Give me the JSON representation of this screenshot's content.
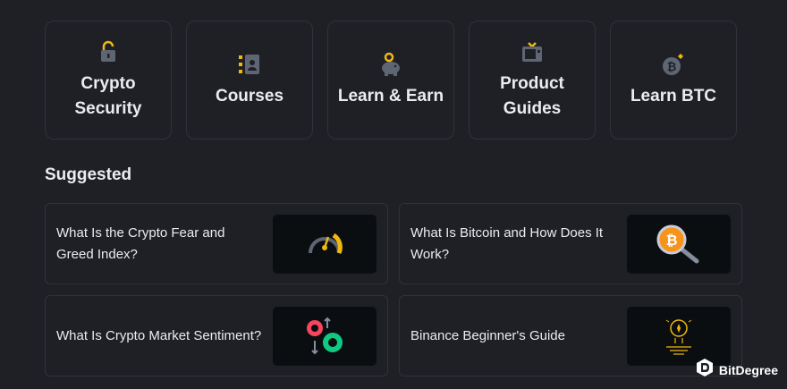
{
  "categories": [
    {
      "label": "Crypto Security",
      "icon": "padlock-icon"
    },
    {
      "label": "Courses",
      "icon": "course-book-icon"
    },
    {
      "label": "Learn & Earn",
      "icon": "piggy-bank-icon"
    },
    {
      "label": "Product Guides",
      "icon": "tv-screen-icon"
    },
    {
      "label": "Learn BTC",
      "icon": "bitcoin-bomb-icon"
    }
  ],
  "suggested": {
    "title": "Suggested",
    "items": [
      {
        "title": "What Is the Crypto Fear and Greed Index?",
        "thumb": "gauge-icon"
      },
      {
        "title": "What Is Bitcoin and How Does It Work?",
        "thumb": "bitcoin-magnifier-icon"
      },
      {
        "title": "What Is Crypto Market Sentiment?",
        "thumb": "sentiment-bull-bear-icon"
      },
      {
        "title": "Binance Beginner's Guide",
        "thumb": "lightbulb-icon"
      }
    ]
  },
  "watermark": {
    "text": "BitDegree"
  },
  "colors": {
    "background": "#1e2026",
    "accent": "#f0b90b",
    "border": "#2f3238",
    "text": "#eaecef",
    "thumb_bg": "#0b0e11"
  }
}
